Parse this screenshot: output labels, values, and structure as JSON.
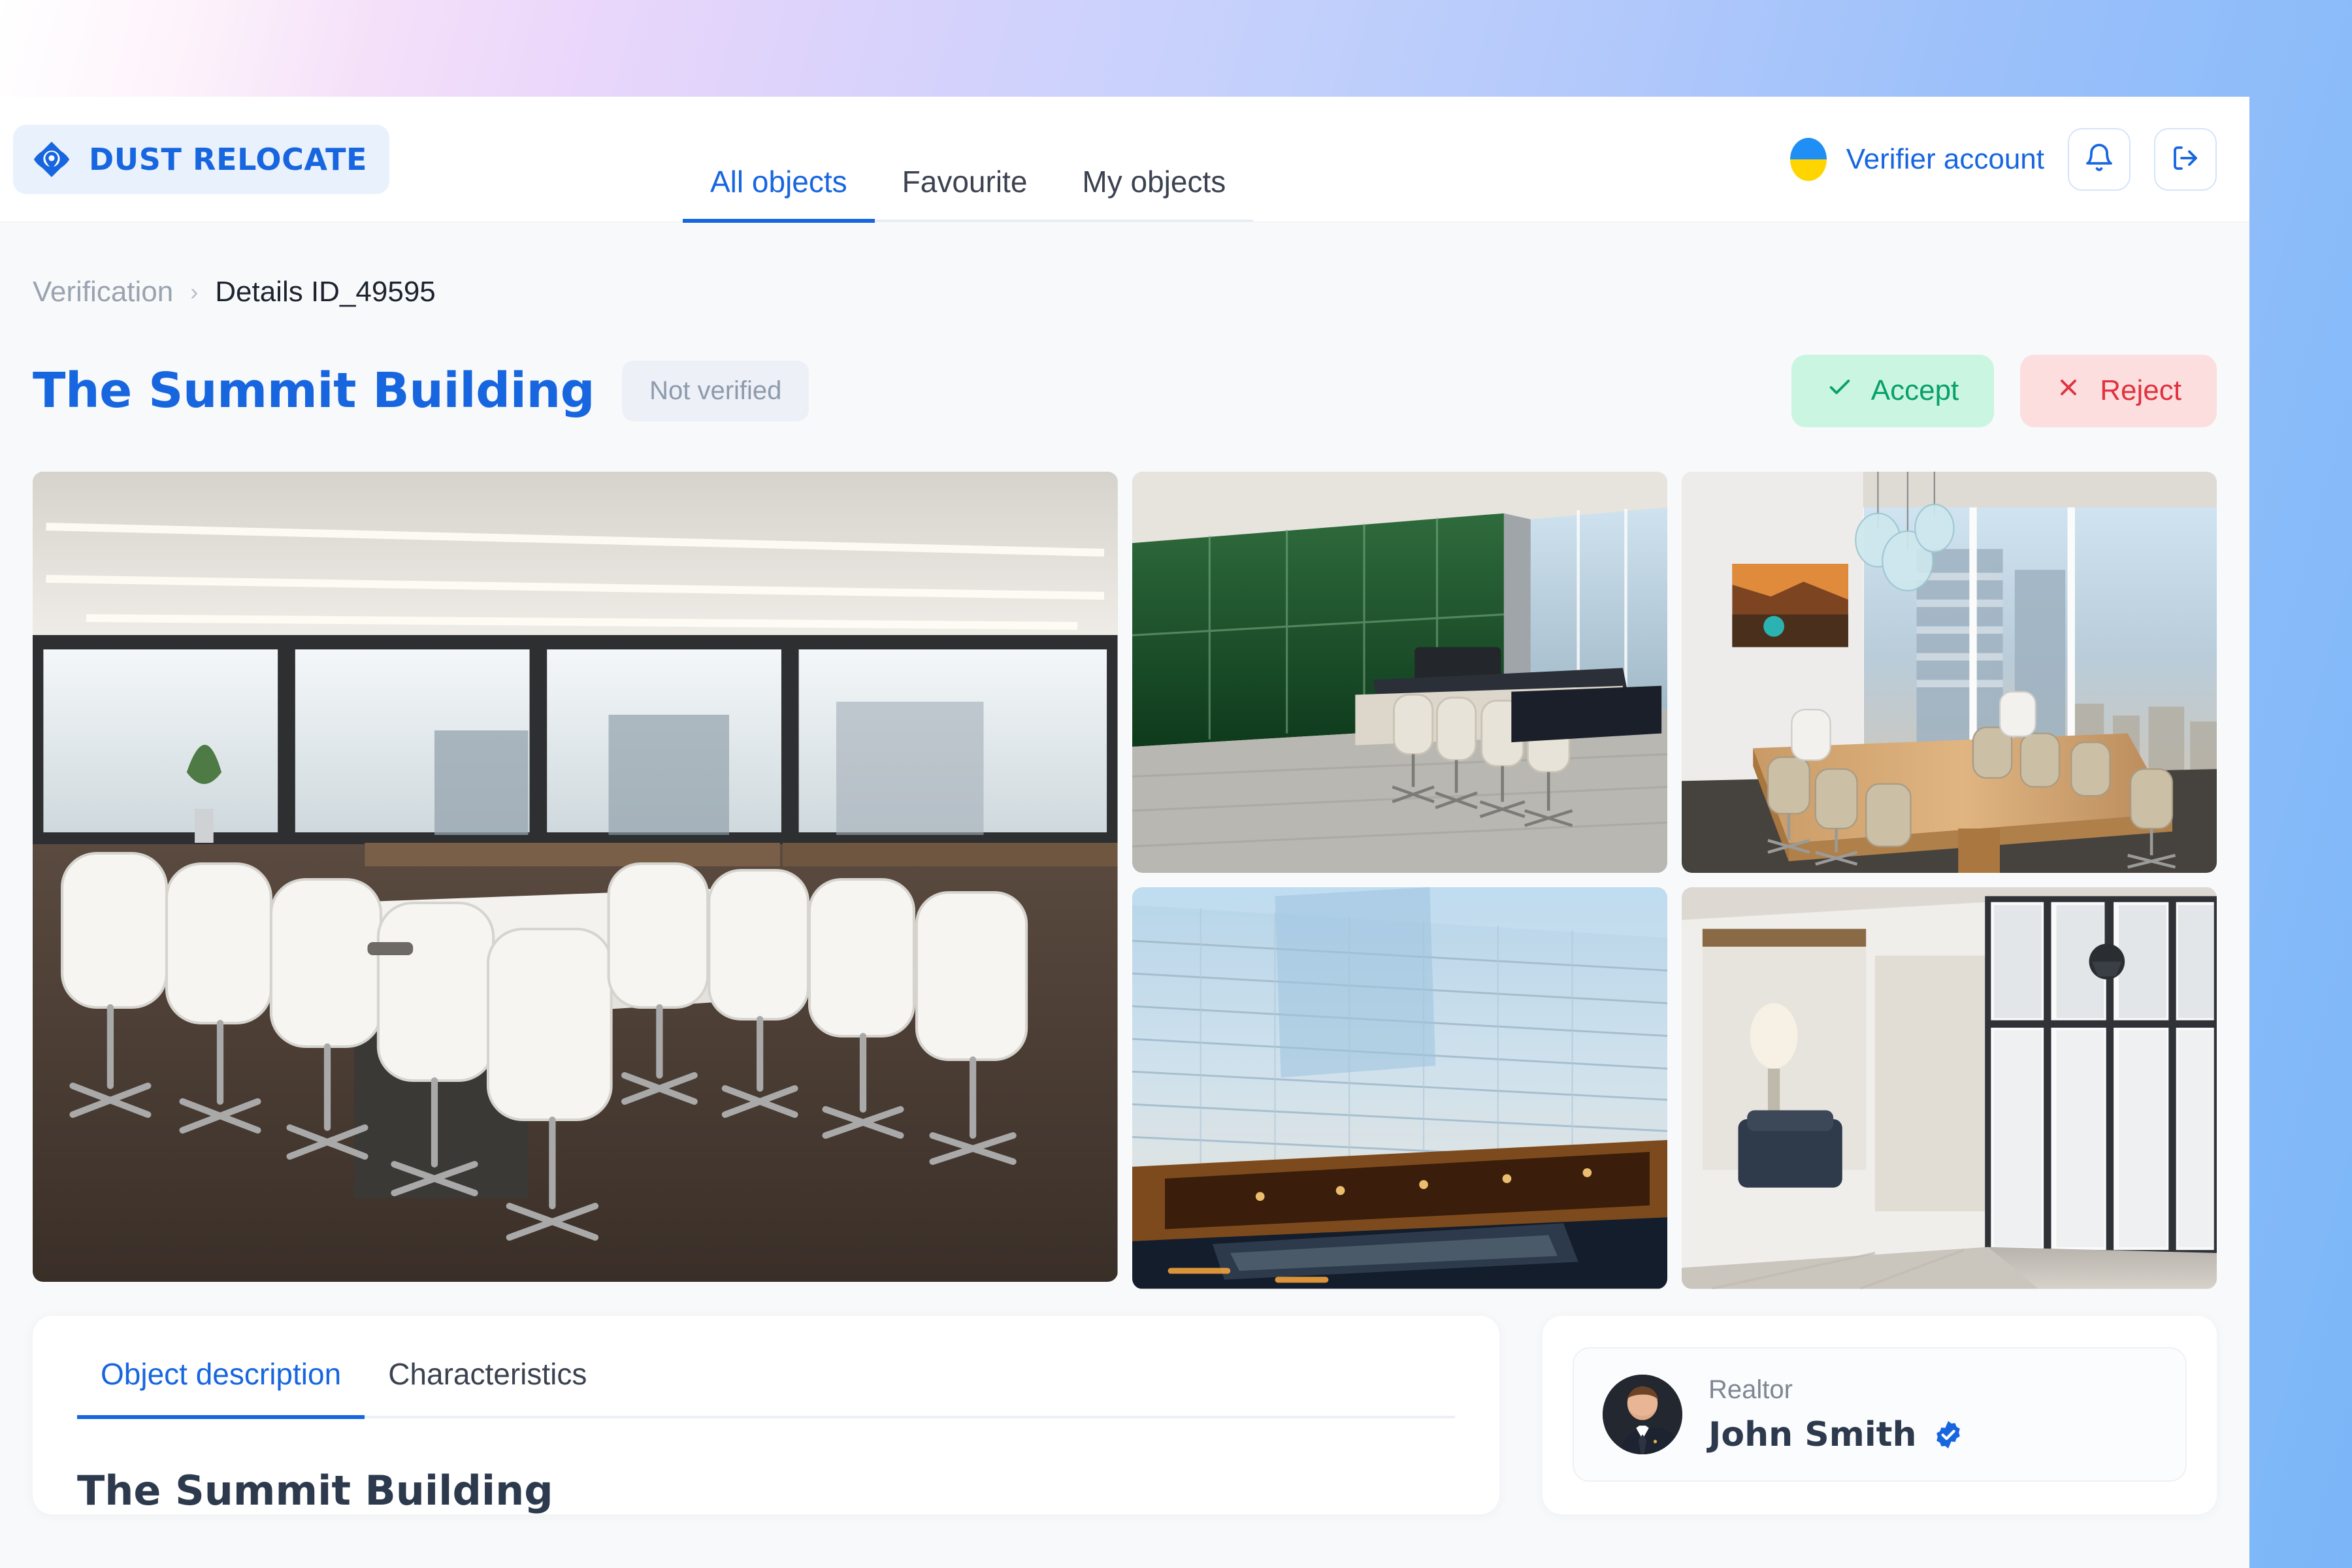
{
  "brand": {
    "name": "DUST RELOCATE",
    "logo_icon": "eye-location-pin-logo",
    "color": "#1766e0"
  },
  "header": {
    "tabs": [
      {
        "label": "All objects",
        "active": true
      },
      {
        "label": "Favourite",
        "active": false
      },
      {
        "label": "My objects",
        "active": false
      }
    ],
    "account": {
      "label": "Verifier account",
      "avatar_icon": "ukraine-flag-avatar"
    },
    "notifications_icon": "bell-icon",
    "logout_icon": "logout-icon"
  },
  "breadcrumb": {
    "parent": "Verification",
    "separator": "›",
    "current": "Details ID_49595"
  },
  "object": {
    "title": "The Summit Building",
    "status": "Not verified"
  },
  "actions": {
    "accept": {
      "label": "Accept",
      "icon": "check-icon",
      "color": "#09a06a"
    },
    "reject": {
      "label": "Reject",
      "icon": "x-icon",
      "color": "#e0323f"
    }
  },
  "gallery": {
    "images": [
      {
        "alt": "Large conference room with white chairs and city view"
      },
      {
        "alt": "Boardroom with green glass wall and long table"
      },
      {
        "alt": "Meeting room with live-edge wood table and skyline"
      },
      {
        "alt": "Glass office tower exterior at dusk"
      },
      {
        "alt": "Modern office corridor with glass partition walls"
      }
    ]
  },
  "details": {
    "tabs": [
      {
        "label": "Object description",
        "active": true
      },
      {
        "label": "Characteristics",
        "active": false
      }
    ],
    "heading": "The Summit Building"
  },
  "realtor": {
    "role": "Realtor",
    "name": "John Smith",
    "verified": true,
    "verified_icon": "verified-check-badge",
    "avatar_icon": "realtor-portrait"
  },
  "colors": {
    "accent": "#1766e0",
    "page_bg": "#f8f9fa",
    "accept_bg": "#c9f5e1",
    "reject_bg": "#fcdede",
    "badge_bg": "#edf0f6"
  }
}
